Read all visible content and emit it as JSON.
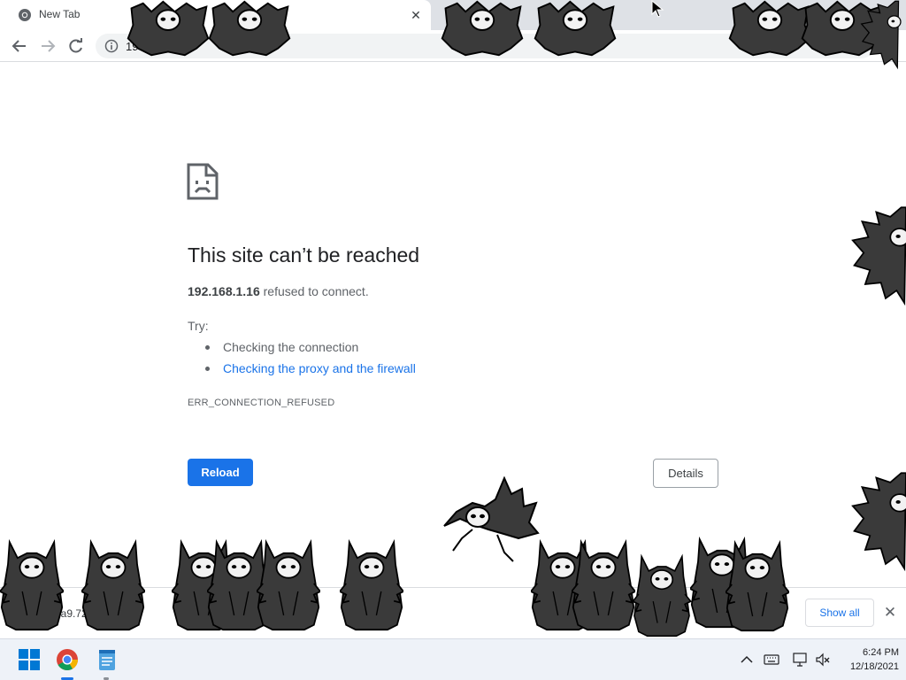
{
  "colors": {
    "accent": "#1a73e8",
    "tabstrip": "#dee1e6",
    "creature_fill": "#3a3a3a",
    "text": "#202124",
    "secondary_text": "#5f6368"
  },
  "browser": {
    "tab": {
      "title": "New Tab",
      "favicon": "chrome-icon",
      "close_icon": "close-icon"
    },
    "toolbar": {
      "back_icon": "back-arrow-icon",
      "forward_icon": "forward-arrow-icon",
      "reload_icon": "reload-icon",
      "site_info_icon": "info-icon",
      "url": "19"
    }
  },
  "error_page": {
    "icon": "sad-page-icon",
    "title": "This site can’t be reached",
    "host": "192.168.1.16",
    "message": "refused to connect.",
    "try_label": "Try:",
    "suggestions": [
      {
        "text": "Checking the connection",
        "is_link": false
      },
      {
        "text": "Checking the proxy and the firewall",
        "is_link": true
      }
    ],
    "error_code": "ERR_CONNECTION_REFUSED",
    "reload_label": "Reload",
    "details_label": "Details"
  },
  "download_shelf": {
    "item_text": "0a9.72",
    "show_all_label": "Show all",
    "close_icon": "close-icon"
  },
  "taskbar": {
    "icons": [
      "windows-start-icon",
      "chrome-icon",
      "notepad-icon"
    ],
    "tray_icons": [
      "chevron-up-icon",
      "keyboard-icon",
      "network-icon",
      "volume-muted-icon"
    ],
    "time": "6:24 PM",
    "date": "12/18/2021"
  }
}
